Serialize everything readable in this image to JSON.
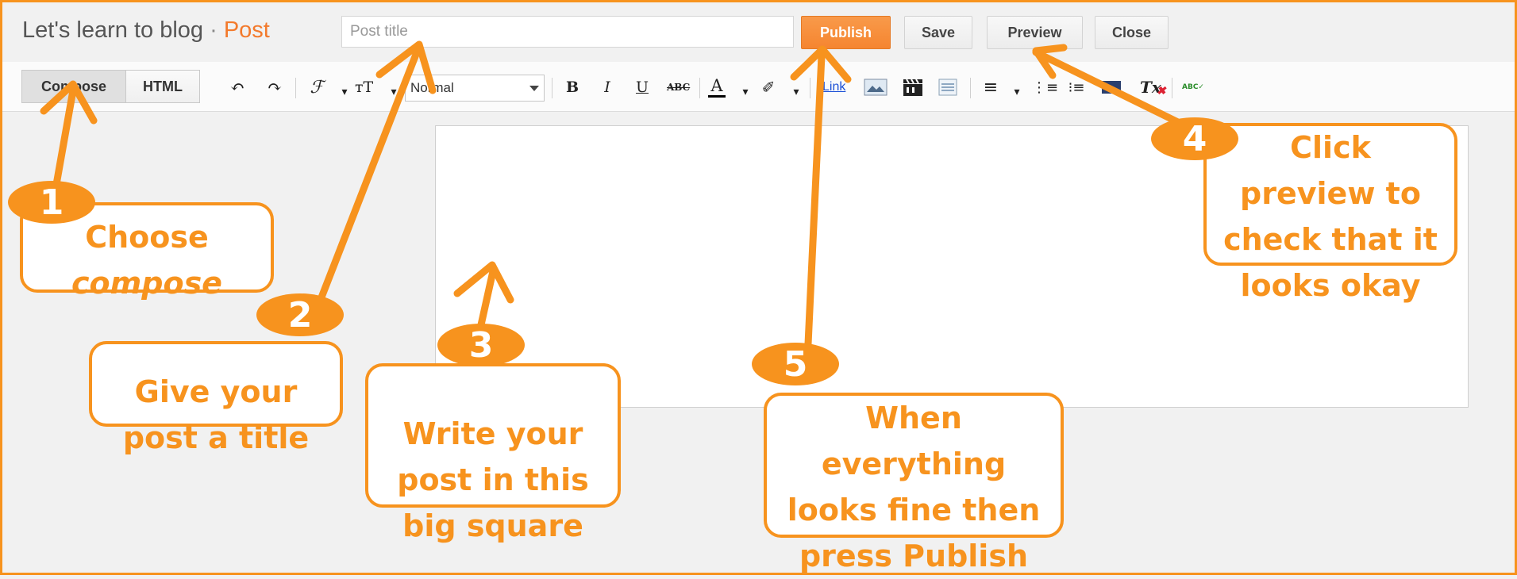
{
  "header": {
    "blog_name": "Let's learn to blog",
    "separator": " · ",
    "section": "Post",
    "title_placeholder": "Post title",
    "buttons": {
      "publish": "Publish",
      "save": "Save",
      "preview": "Preview",
      "close": "Close"
    }
  },
  "toolbar": {
    "modes": {
      "compose": "Compose",
      "html": "HTML"
    },
    "font_size_value": "Normal",
    "icons": [
      "undo-icon",
      "redo-icon",
      "font-family-icon",
      "font-size-icon",
      "bold-icon",
      "italic-icon",
      "underline-icon",
      "strikethrough-icon",
      "text-color-icon",
      "highlight-icon",
      "link-icon",
      "image-icon",
      "video-icon",
      "jump-break-icon",
      "align-icon",
      "numbered-list-icon",
      "bulleted-list-icon",
      "quote-icon",
      "remove-formatting-icon",
      "spellcheck-icon"
    ],
    "glyphs": {
      "undo": "↶",
      "redo": "↷",
      "font_family": "ℱ",
      "font_size": "тT",
      "bold": "B",
      "italic": "I",
      "underline": "U",
      "strike": "ABC",
      "text_color": "A",
      "highlight": "✐",
      "link": "Link",
      "align": "≡",
      "numbered": "⋮≡",
      "bulleted": "⁝≡",
      "remove_format": "Tx",
      "spellcheck": "ABC✓"
    }
  },
  "annotations": [
    {
      "number": "1",
      "text": "Choose\ncompose"
    },
    {
      "number": "2",
      "text": "Give your\npost a title"
    },
    {
      "number": "3",
      "text": "Write  your\npost in this\nbig square"
    },
    {
      "number": "4",
      "text": "Click\npreview to\ncheck that it\nlooks okay"
    },
    {
      "number": "5",
      "text": "When\neverything\nlooks fine then\npress Publish"
    }
  ],
  "colors": {
    "accent": "#f7931e",
    "publish_button": "#f58530",
    "background": "#f1f1f1"
  }
}
